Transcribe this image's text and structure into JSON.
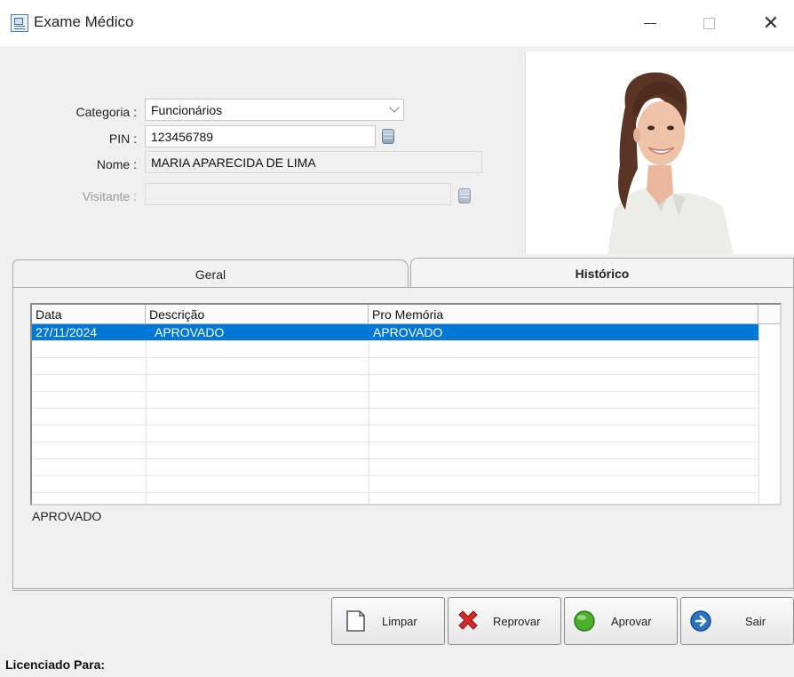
{
  "window": {
    "title": "Exame Médico",
    "controls": [
      "minimize",
      "maximize",
      "close"
    ]
  },
  "form": {
    "categoria": {
      "label": "Categoria :",
      "value": "Funcionários"
    },
    "pin": {
      "label": "PIN :",
      "value": "123456789"
    },
    "nome": {
      "label": "Nome :",
      "value": "MARIA APARECIDA DE LIMA"
    },
    "visitante": {
      "label": "Visitante :",
      "value": ""
    }
  },
  "tabs": [
    {
      "label": "Geral",
      "active": false
    },
    {
      "label": "Histórico",
      "active": true
    }
  ],
  "history_grid": {
    "columns": [
      "Data",
      "Descrição",
      "Pro Memória"
    ],
    "rows": [
      {
        "data": "27/11/2024",
        "descricao": "APROVADO",
        "pro_memoria": "APROVADO",
        "selected": true
      }
    ]
  },
  "memo": "APROVADO",
  "buttons": {
    "limpar": "Limpar",
    "reprovar": "Reprovar",
    "aprovar": "Aprovar",
    "sair": "Sair"
  },
  "footer": {
    "licensed_label": "Licenciado Para:"
  },
  "colors": {
    "selection": "#0078d7",
    "window_bg": "#f0f0f0"
  }
}
